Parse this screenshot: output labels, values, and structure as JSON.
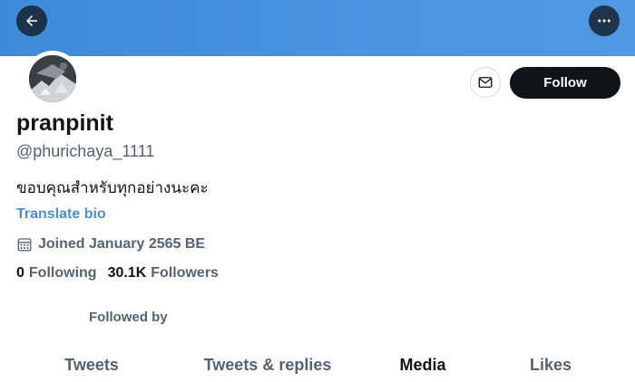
{
  "profile": {
    "display_name": "pranpinit",
    "handle": "@phurichaya_1111",
    "bio": "ขอบคุณสำหรับทุกอย่างนะคะ",
    "translate_label": "Translate bio",
    "joined": "Joined January 2565 BE",
    "following_count": "0",
    "following_label": "Following",
    "followers_count": "30.1K",
    "followers_label": "Followers",
    "followed_by_label": "Followed by"
  },
  "actions": {
    "follow_label": "Follow"
  },
  "tabs": [
    {
      "label": "Tweets",
      "active": false
    },
    {
      "label": "Tweets & replies",
      "active": false
    },
    {
      "label": "Media",
      "active": true
    },
    {
      "label": "Likes",
      "active": false
    }
  ],
  "colors": {
    "banner": "#4a94e0",
    "link": "#4a90c8",
    "primary_text": "#0f1419",
    "secondary_text": "#536471",
    "follow_bg": "#0f1419"
  },
  "icons": {
    "back": "arrow-left-icon",
    "more": "more-horizontal-icon",
    "message": "envelope-icon",
    "calendar": "calendar-icon"
  }
}
